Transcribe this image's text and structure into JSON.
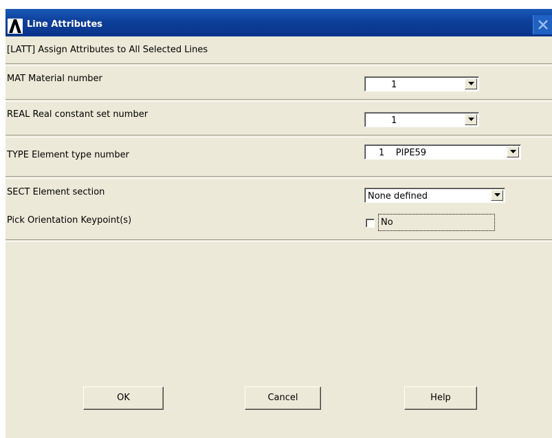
{
  "window": {
    "title": "Line Attributes",
    "logo_icon": "ansys-logo-icon",
    "close_icon": "close-icon"
  },
  "header": {
    "command": "[LATT]  Assign Attributes to All Selected Lines"
  },
  "fields": {
    "mat": {
      "label": "MAT   Material number",
      "value": "1"
    },
    "real": {
      "label": "REAL  Real constant set number",
      "value": "1"
    },
    "type": {
      "label": "TYPE  Element type number",
      "value": "1    PIPE59"
    },
    "sect": {
      "label": "SECT  Element section",
      "value": "None defined"
    },
    "orient": {
      "label": "Pick Orientation Keypoint(s)",
      "checkbox_label": "No",
      "checked": false
    }
  },
  "buttons": {
    "ok": "OK",
    "cancel": "Cancel",
    "help": "Help"
  },
  "colors": {
    "titlebar": "#0d3f99",
    "dialog_bg": "#ece9d8",
    "title_text": "#ffffff"
  }
}
